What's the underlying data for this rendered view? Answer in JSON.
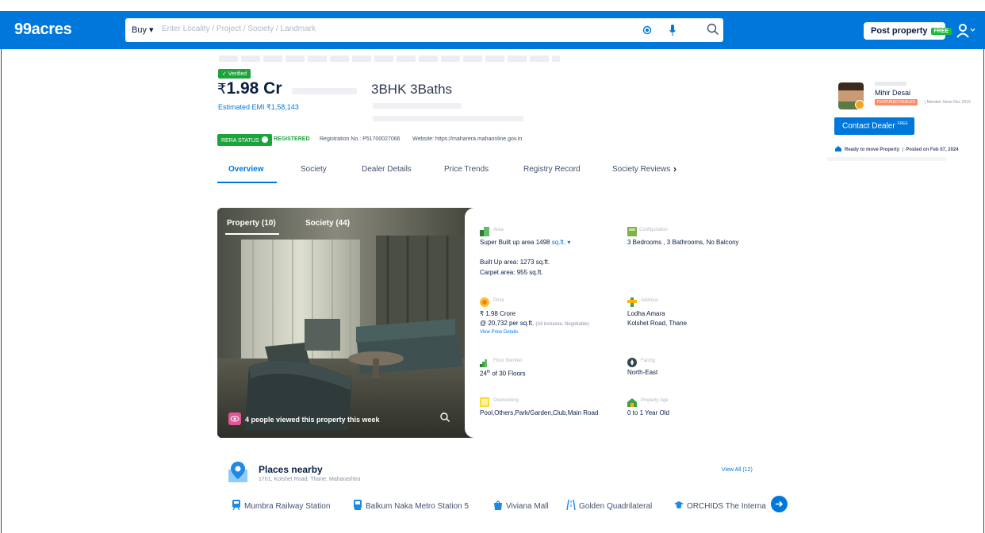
{
  "header": {
    "logo": "99acres",
    "buy_label": "Buy ▾",
    "search_placeholder": "Enter Locality / Project / Society / Landmark",
    "post_property_label": "Post property",
    "post_property_tag": "FREE"
  },
  "listing": {
    "verified_label": "✓ Verified",
    "price_symbol": "₹",
    "price": "1.98 Cr",
    "title": "3BHK 3Baths",
    "emi": "Estimated EMI ₹1,58,143",
    "rera_status_label": "RERA STATUS",
    "rera_value": "REGISTERED",
    "registration": "Registration No.: P51700027066",
    "website": "Website: https://maharera.mahaonline.gov.in"
  },
  "tabs": [
    {
      "label": "Overview",
      "active": true
    },
    {
      "label": "Society",
      "active": false
    },
    {
      "label": "Dealer Details",
      "active": false
    },
    {
      "label": "Price Trends",
      "active": false
    },
    {
      "label": "Registry Record",
      "active": false
    },
    {
      "label": "Society Reviews",
      "active": false
    }
  ],
  "tabs_more": "›",
  "dealer": {
    "name": "Mihir Desai",
    "featured_label": "FEATURED DEALER",
    "member_since": "| Member Since Dec 2019",
    "contact_label": "Contact Dealer",
    "contact_tag": "FREE",
    "status_ready": "Ready to move Property",
    "status_posted": "Posted on Feb 07, 2024"
  },
  "gallery": {
    "tab_property": "Property (10)",
    "tab_society": "Society (44)",
    "viewed_text": "4 people viewed this property this week"
  },
  "details": {
    "area_label": "Area",
    "super_built": "Super Built up area 1498",
    "unit": "sq.ft. ▾",
    "built_up": "Built Up area: 1273 sq.ft.",
    "carpet": "Carpet area: 955 sq.ft.",
    "config_label": "Configuration",
    "config": "3 Bedrooms , 3 Bathrooms, No Balcony",
    "price_label": "Price",
    "price_value": "₹ 1.98 Crore",
    "price_per_sqft": "@ 20,732 per sq.ft.",
    "price_note": "(All inclusive. Negotiable)",
    "price_link": "View Price Details",
    "address_label": "Address",
    "address_line1": "Lodha Amara",
    "address_line2": "Kolshet Road, Thane",
    "floor_label": "Floor Number",
    "floor_num": "24",
    "floor_sup": "th",
    "floor_rest": "of 30 Floors",
    "facing_label": "Facing",
    "facing": "North-East",
    "overlooking_label": "Overlooking",
    "overlooking": "Pool,Others,Park/Garden,Club,Main Road",
    "age_label": "Property Age",
    "age": "0 to 1 Year Old"
  },
  "places": {
    "title": "Places nearby",
    "address": "1701, Kolshet Road, Thane, Maharashtra",
    "view_all": "View All (12)",
    "items": [
      "Mumbra Railway Station",
      "Balkum Naka Metro Station 5",
      "Viviana Mall",
      "Golden Quadrilateral",
      "ORCHIDS The Interna"
    ]
  },
  "colors": {
    "brand_blue": "#0078DB",
    "green": "#1CA33C"
  }
}
